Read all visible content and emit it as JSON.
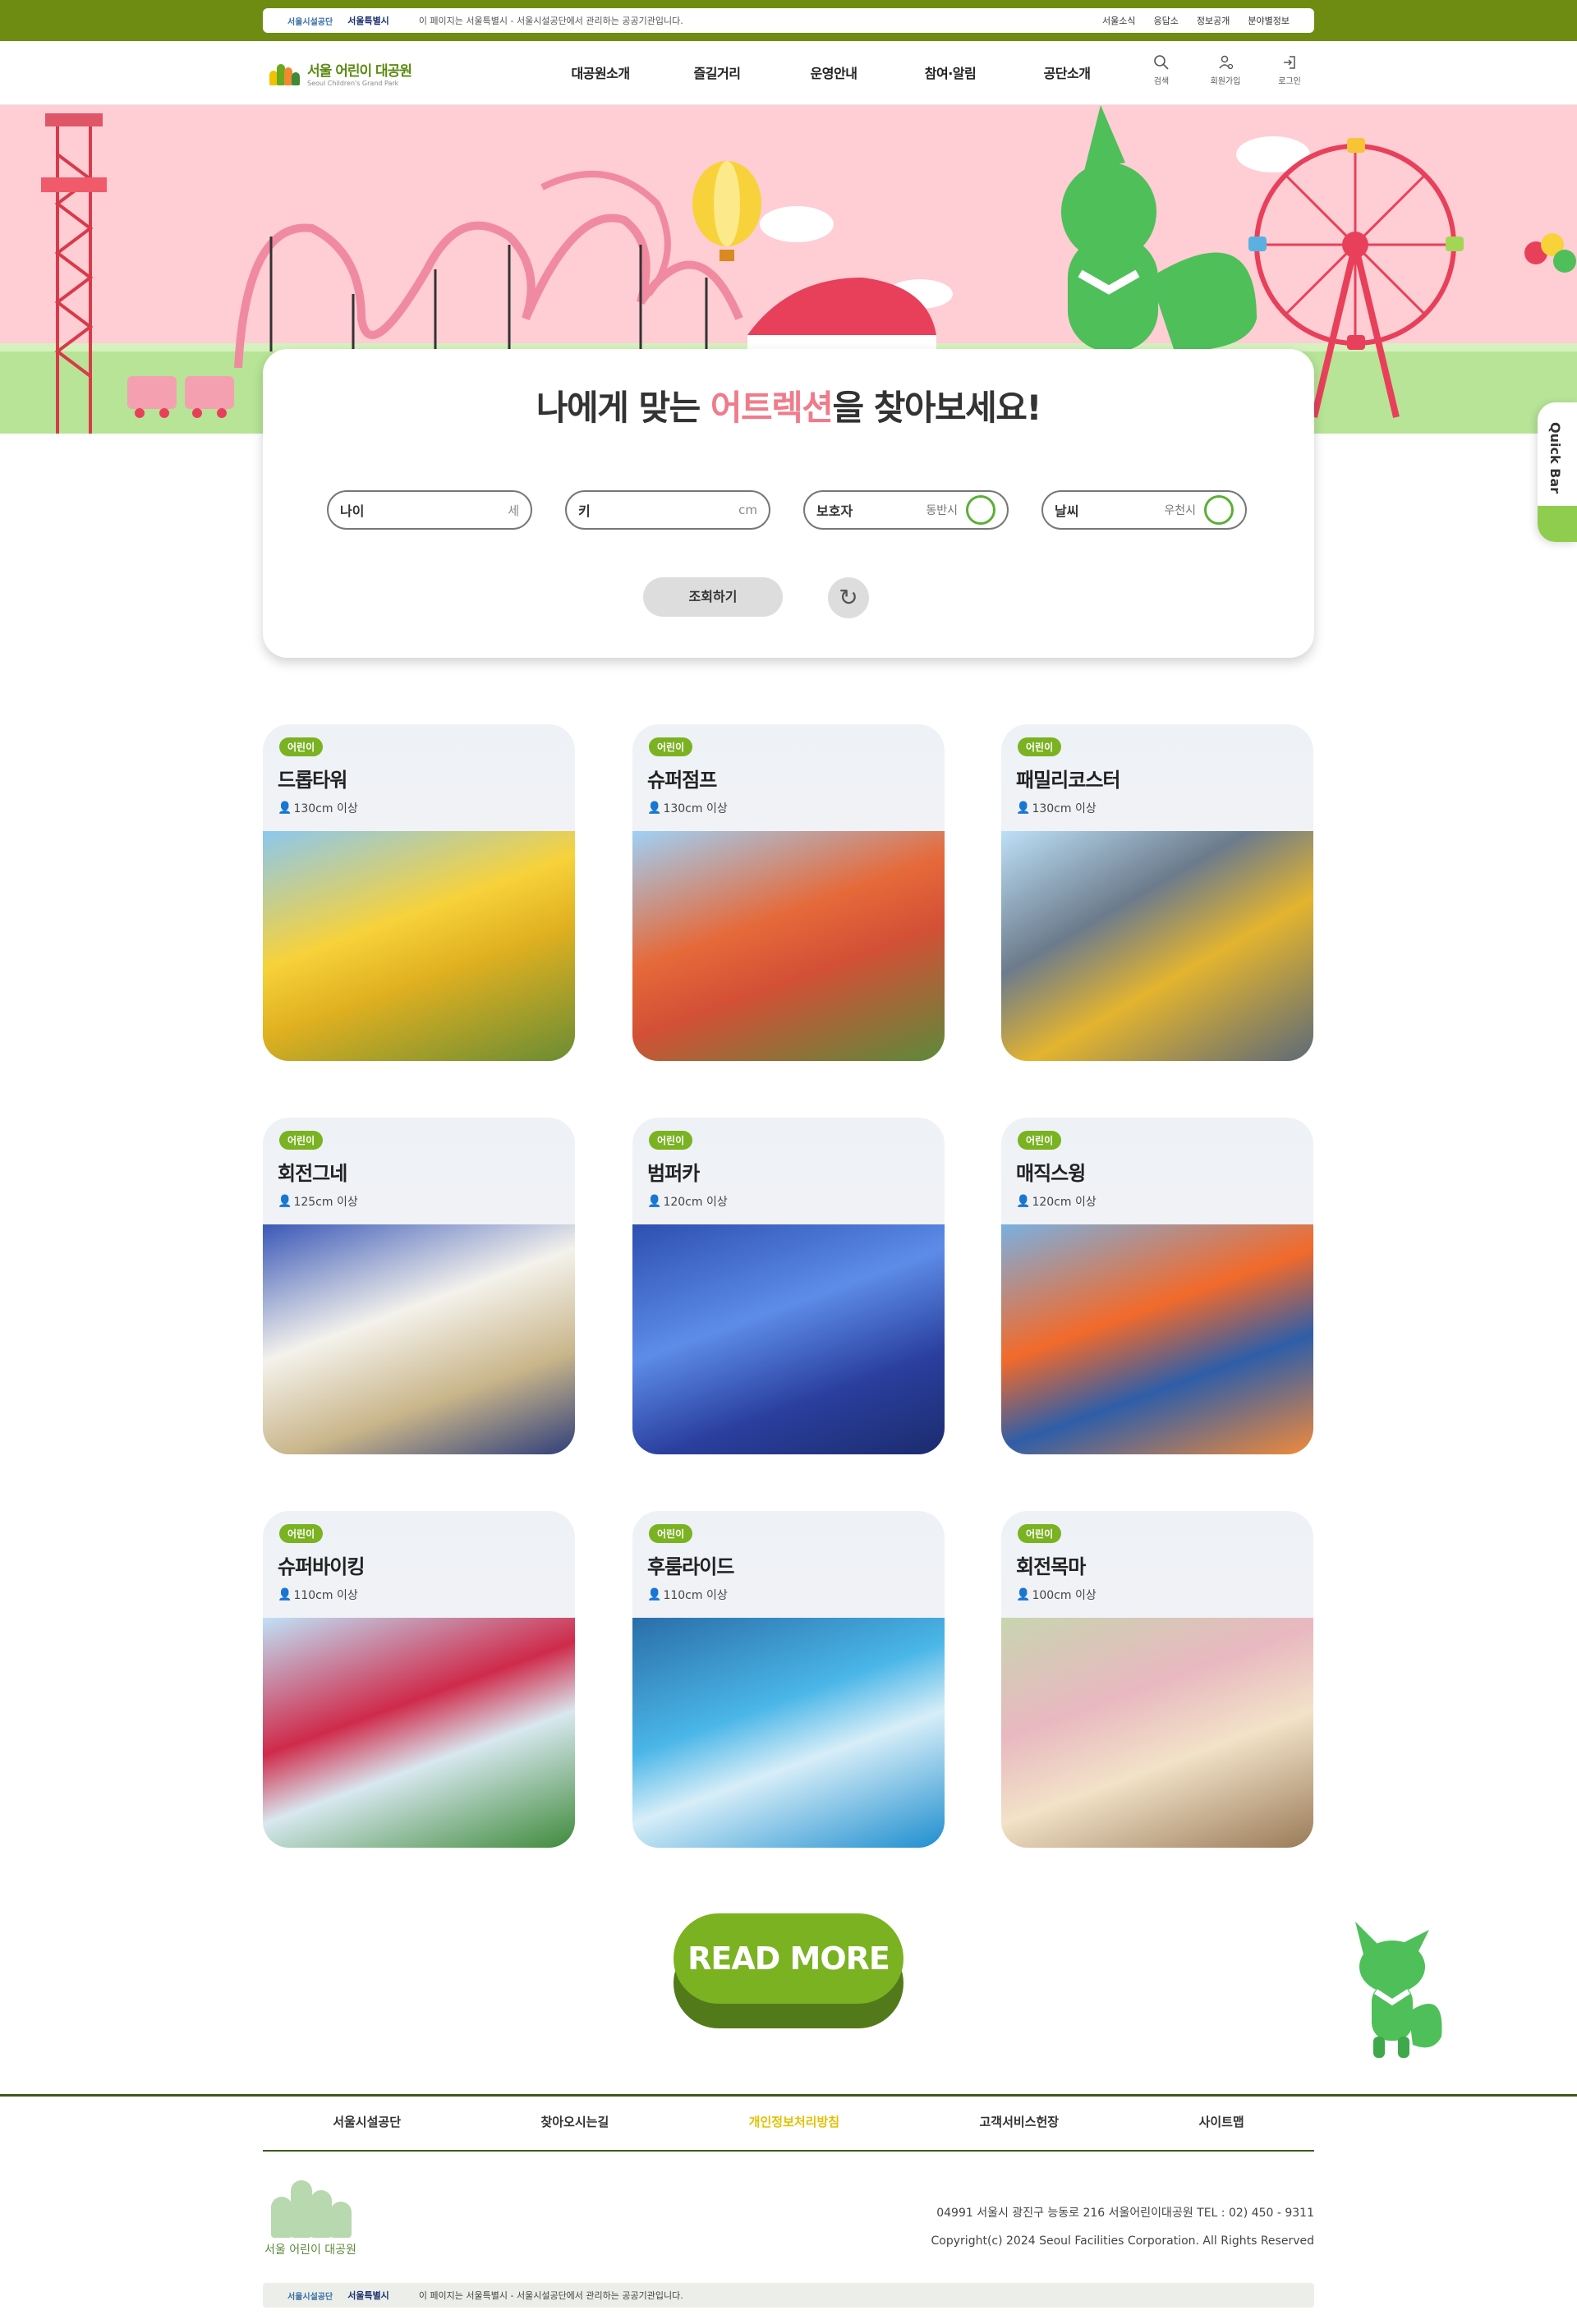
{
  "topbar": {
    "logo_left": "서울시설공단",
    "logo_right": "서울특별시",
    "notice": "이 페이지는 서울특별시 - 서울시설공단에서 관리하는 공공기관입니다.",
    "links": [
      "서울소식",
      "응답소",
      "정보공개",
      "분야별정보"
    ]
  },
  "header": {
    "brand_ko": "서울 어린이 대공원",
    "brand_en": "Seoul Children's Grand Park",
    "menu": [
      "대공원소개",
      "즐길거리",
      "운영안내",
      "참여·알림",
      "공단소개"
    ],
    "util": [
      {
        "label": "검색",
        "icon": "search-icon"
      },
      {
        "label": "회원가입",
        "icon": "user-plus-icon"
      },
      {
        "label": "로그인",
        "icon": "login-icon"
      }
    ]
  },
  "search": {
    "title_pre": "나에게 맞는 ",
    "title_accent": "어트렉션",
    "title_post": "을 찾아보세요!",
    "fields": [
      {
        "label": "나이",
        "unit": "세"
      },
      {
        "label": "키",
        "unit": "cm"
      },
      {
        "label": "보호자",
        "toggle": "동반시"
      },
      {
        "label": "날씨",
        "toggle": "우천시"
      }
    ],
    "search_button": "조회하기",
    "reset_icon": "↻"
  },
  "cards": [
    {
      "badge": "어린이",
      "name": "드롭타워",
      "height": "130cm 이상"
    },
    {
      "badge": "어린이",
      "name": "슈퍼점프",
      "height": "130cm 이상"
    },
    {
      "badge": "어린이",
      "name": "패밀리코스터",
      "height": "130cm 이상"
    },
    {
      "badge": "어린이",
      "name": "회전그네",
      "height": "125cm 이상"
    },
    {
      "badge": "어린이",
      "name": "범퍼카",
      "height": "120cm 이상"
    },
    {
      "badge": "어린이",
      "name": "매직스윙",
      "height": "120cm 이상"
    },
    {
      "badge": "어린이",
      "name": "슈퍼바이킹",
      "height": "110cm 이상"
    },
    {
      "badge": "어린이",
      "name": "후룸라이드",
      "height": "110cm 이상"
    },
    {
      "badge": "어린이",
      "name": "회전목마",
      "height": "100cm 이상"
    }
  ],
  "read_more": "READ MORE",
  "quick_bar": "Quick Bar",
  "footer": {
    "nav": [
      "서울시설공단",
      "찾아오시는길",
      "개인정보처리방침",
      "고객서비스헌장",
      "사이트맵"
    ],
    "logo_text": "서울 어린이 대공원",
    "address": "04991 서울시 광진구 능동로 216 서울어린이대공원 TEL : 02) 450 - 9311",
    "copyright": "Copyright(c) 2024 Seoul Facilities Corporation. All Rights Reserved",
    "bottom_logo_left": "서울시설공단",
    "bottom_logo_right": "서울특별시",
    "bottom_notice": "이 페이지는 서울특별시 - 서울시설공단에서 관리하는 공공기관입니다."
  },
  "colors": {
    "brand_green": "#7ab221",
    "dark_green": "#3d5a14",
    "hero_pink": "#ffcdd4",
    "accent_pink": "#f07b8a"
  }
}
